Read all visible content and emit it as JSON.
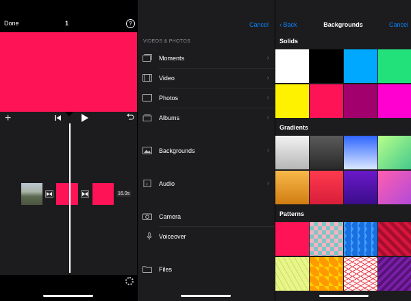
{
  "editor": {
    "done_label": "Done",
    "clip_count": "1",
    "help_label": "?",
    "duration_label": "16.0s",
    "colors": {
      "accent": "#ff1357",
      "timeline_bg": "#1c1c1e"
    },
    "icons": [
      "help-icon",
      "add-icon",
      "skip-back-icon",
      "play-icon",
      "undo-icon",
      "transition-icon",
      "settings-icon"
    ]
  },
  "media": {
    "cancel_label": "Cancel",
    "section_header": "VIDEOS & PHOTOS",
    "rows": [
      {
        "label": "Moments",
        "icon": "moments-icon"
      },
      {
        "label": "Video",
        "icon": "film-icon"
      },
      {
        "label": "Photos",
        "icon": "photo-icon"
      },
      {
        "label": "Albums",
        "icon": "albums-icon"
      },
      {
        "label": "Backgrounds",
        "icon": "image-icon"
      },
      {
        "label": "Audio",
        "icon": "music-icon"
      },
      {
        "label": "Camera",
        "icon": "camera-icon"
      },
      {
        "label": "Voiceover",
        "icon": "microphone-icon"
      },
      {
        "label": "Files",
        "icon": "folder-icon"
      }
    ]
  },
  "backgrounds": {
    "back_label": "Back",
    "title": "Backgrounds",
    "cancel_label": "Cancel",
    "sections": {
      "solids": "Solids",
      "gradients": "Gradients",
      "patterns": "Patterns"
    },
    "solids": [
      "#ffffff",
      "#000000",
      "#00a8ff",
      "#22e07a",
      "#fff200",
      "#ff1357",
      "#a1006d",
      "#ff00d0"
    ],
    "gradients": [
      "light-gray",
      "dark-gray",
      "blue",
      "green",
      "gold",
      "red",
      "purple",
      "pink"
    ],
    "patterns": [
      "solid-pink",
      "teal-pink-diamonds",
      "blue-triangles",
      "red-chevrons",
      "yellow-green-lines",
      "orange-triangles",
      "red-grid",
      "purple-stripes"
    ]
  }
}
